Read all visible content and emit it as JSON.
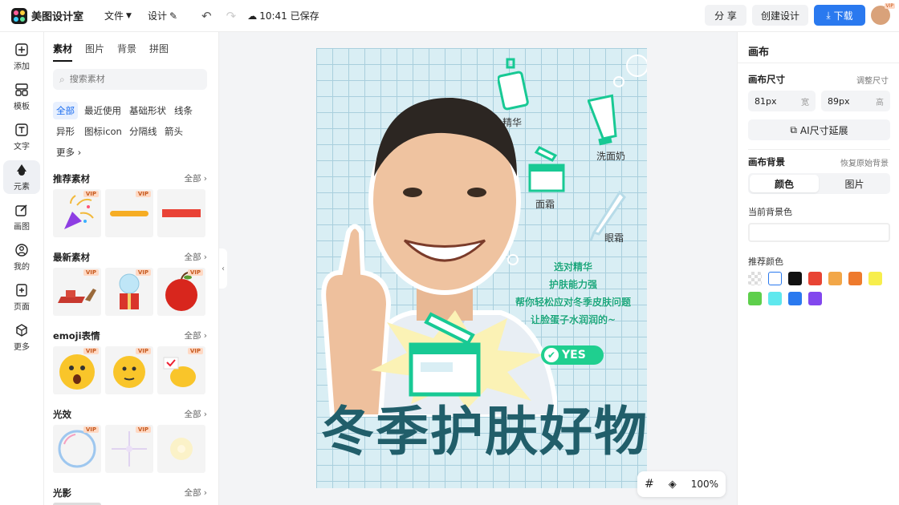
{
  "app": {
    "name": "美图设计室"
  },
  "topbar": {
    "file_label": "文件",
    "design_label": "设计",
    "save_status": "10:41 已保存",
    "share_label": "分 享",
    "create_label": "创建设计",
    "download_label": "下载",
    "avatar_badge": "VIP"
  },
  "rail": [
    {
      "label": "添加",
      "icon": "plus-square-icon"
    },
    {
      "label": "模板",
      "icon": "template-grid-icon"
    },
    {
      "label": "文字",
      "icon": "text-T-icon"
    },
    {
      "label": "元素",
      "icon": "shapes-icon"
    },
    {
      "label": "画图",
      "icon": "pencil-square-icon"
    },
    {
      "label": "我的",
      "icon": "user-circle-icon"
    },
    {
      "label": "页面",
      "icon": "page-plus-icon"
    },
    {
      "label": "更多",
      "icon": "cube-icon"
    }
  ],
  "panel": {
    "tabs": [
      "素材",
      "图片",
      "背景",
      "拼图"
    ],
    "search_placeholder": "搜索素材",
    "chips": [
      "全部",
      "最近使用",
      "基础形状",
      "线条",
      "异形",
      "图标icon",
      "分隔线",
      "箭头",
      "更多"
    ],
    "all_label": "全部",
    "vip_label": "VIP",
    "sections": [
      "推荐素材",
      "最新素材",
      "emoji表情",
      "光效",
      "光影"
    ]
  },
  "canvas": {
    "labels": [
      "精华",
      "洗面奶",
      "面霜",
      "眼霜"
    ],
    "slogan": [
      "选对精华",
      "护肤能力强",
      "帮你轻松应对冬季皮肤问题",
      "让脸蛋子水润润的~"
    ],
    "yes_text": "YES",
    "big_title": "冬季护肤好物"
  },
  "zoom": {
    "value": "100%"
  },
  "right": {
    "title": "画布",
    "size_label": "画布尺寸",
    "size_link": "调整尺寸",
    "width_value": "81px",
    "width_unit": "宽",
    "height_value": "89px",
    "height_unit": "高",
    "ai_button": "AI尺寸延展",
    "bg_label": "画布背景",
    "bg_link": "恢复原始背景",
    "seg_color": "颜色",
    "seg_image": "图片",
    "current_bg_label": "当前背景色",
    "rec_label": "推荐颜色",
    "colors": [
      "transparent",
      "#ffffff",
      "#111111",
      "#e84434",
      "#f2a748",
      "#ee7a2d",
      "#f7ee4c",
      "#5ecf4b",
      "#5fe8ee",
      "#2a79ef",
      "#8247ee"
    ]
  }
}
